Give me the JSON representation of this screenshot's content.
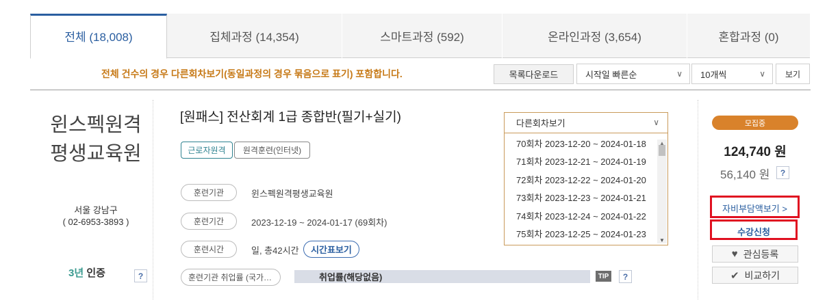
{
  "tabs": [
    {
      "label": "전체 (18,008)",
      "active": true
    },
    {
      "label": "집체과정 (14,354)",
      "active": false
    },
    {
      "label": "스마트과정 (592)",
      "active": false
    },
    {
      "label": "온라인과정 (3,654)",
      "active": false
    },
    {
      "label": "혼합과정 (0)",
      "active": false
    }
  ],
  "toolbar": {
    "notice": "전체 건수의 경우 다른회차보기(동일과정의 경우 묶음으로 표기) 포함합니다.",
    "download_label": "목록다운로드",
    "sort_value": "시작일 빠른순",
    "count_value": "10개씩",
    "view_label": "보기"
  },
  "institution": {
    "name_line1": "윈스펙원격",
    "name_line2": "평생교육원",
    "location": "서울 강남구",
    "phone": "( 02-6953-3893 )",
    "cert_number": "3년",
    "cert_label": "인증",
    "help": "?"
  },
  "course": {
    "title": "[원패스] 전산회계 1급 종합반(필기+실기)",
    "tags": [
      "근로자원격",
      "원격훈련(인터넷)"
    ],
    "rows": [
      {
        "label": "훈련기관",
        "value": "윈스펙원격평생교육원"
      },
      {
        "label": "훈련기간",
        "value": "2023-12-19 ~ 2024-01-17 (69회차)"
      },
      {
        "label": "훈련시간",
        "value": "일, 총42시간"
      }
    ],
    "timetable_label": "시간표보기",
    "employment_label": "훈련기관 취업률 (국가…",
    "employment_value": "취업률(해당없음)",
    "tip_label": "TIP",
    "tip_help": "?"
  },
  "other_sessions": {
    "header": "다른회차보기",
    "items": [
      "70회차 2023-12-20 ~ 2024-01-18",
      "71회차 2023-12-21 ~ 2024-01-19",
      "72회차 2023-12-22 ~ 2024-01-20",
      "73회차 2023-12-23 ~ 2024-01-21",
      "74회차 2023-12-24 ~ 2024-01-22",
      "75회차 2023-12-25 ~ 2024-01-23"
    ]
  },
  "pricing": {
    "status": "모집중",
    "price": "124,740 원",
    "self_pay": "56,140 원",
    "help": "?",
    "self_pay_link": "자비부담액보기 >",
    "enroll_label": "수강신청",
    "wishlist_label": "관심등록",
    "compare_label": "비교하기"
  },
  "colors": {
    "accent_blue": "#2a5ea0",
    "notice_orange": "#c77a18",
    "status_orange": "#d9822b",
    "highlight_red": "#e01020",
    "teal": "#2e8290"
  },
  "icons": [
    "chevron-down-icon",
    "heart-icon",
    "check-icon",
    "help-icon"
  ]
}
